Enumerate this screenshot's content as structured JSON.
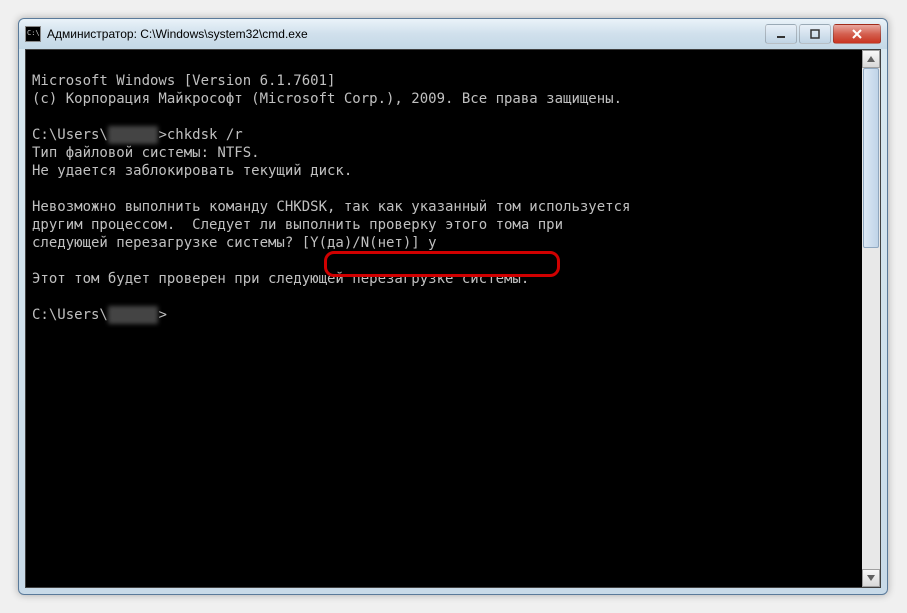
{
  "window": {
    "title": "Администратор: C:\\Windows\\system32\\cmd.exe"
  },
  "terminal": {
    "line1": "Microsoft Windows [Version 6.1.7601]",
    "line2": "(c) Корпорация Майкрософт (Microsoft Corp.), 2009. Все права защищены.",
    "prompt1_prefix": "C:\\Users\\",
    "prompt1_user": "██████",
    "prompt1_suffix": ">chkdsk /r",
    "line4": "Тип файловой системы: NTFS.",
    "line5": "Не удается заблокировать текущий диск.",
    "line6": "Невозможно выполнить команду CHKDSK, так как указанный том используется",
    "line7": "другим процессом.  Следует ли выполнить проверку этого тома при",
    "line8_prefix": "следующей перезагрузке системы? ",
    "line8_prompt": "[Y(да)/N(нет)] y",
    "line9": "Этот том будет проверен при следующей перезагрузке системы.",
    "prompt2_prefix": "C:\\Users\\",
    "prompt2_user": "██████",
    "prompt2_suffix": ">"
  }
}
